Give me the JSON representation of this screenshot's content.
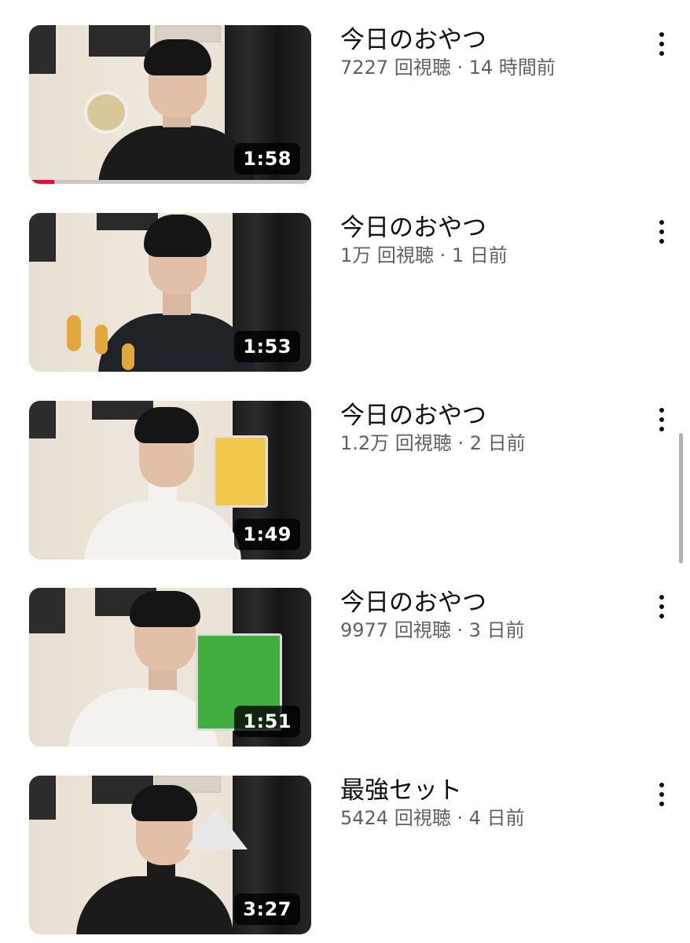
{
  "videos": [
    {
      "title": "今日のおやつ",
      "views": "7227 回視聴",
      "separator": "·",
      "age": "14 時間前",
      "duration": "1:58",
      "watch_progress": 0.09,
      "shirt": "black"
    },
    {
      "title": "今日のおやつ",
      "views": "1万 回視聴",
      "separator": "·",
      "age": "1 日前",
      "duration": "1:53",
      "watch_progress": 0,
      "shirt": "hoodie"
    },
    {
      "title": "今日のおやつ",
      "views": "1.2万 回視聴",
      "separator": "·",
      "age": "2 日前",
      "duration": "1:49",
      "watch_progress": 0,
      "shirt": "white"
    },
    {
      "title": "今日のおやつ",
      "views": "9977 回視聴",
      "separator": "·",
      "age": "3 日前",
      "duration": "1:51",
      "watch_progress": 0,
      "shirt": "white"
    },
    {
      "title": "最強セット",
      "views": "5424 回視聴",
      "separator": "·",
      "age": "4 日前",
      "duration": "3:27",
      "watch_progress": 0,
      "shirt": "black"
    }
  ],
  "icons": {
    "menu": "more-vertical-icon"
  },
  "colors": {
    "progress": "#ff0033",
    "meta_text": "#606060"
  }
}
